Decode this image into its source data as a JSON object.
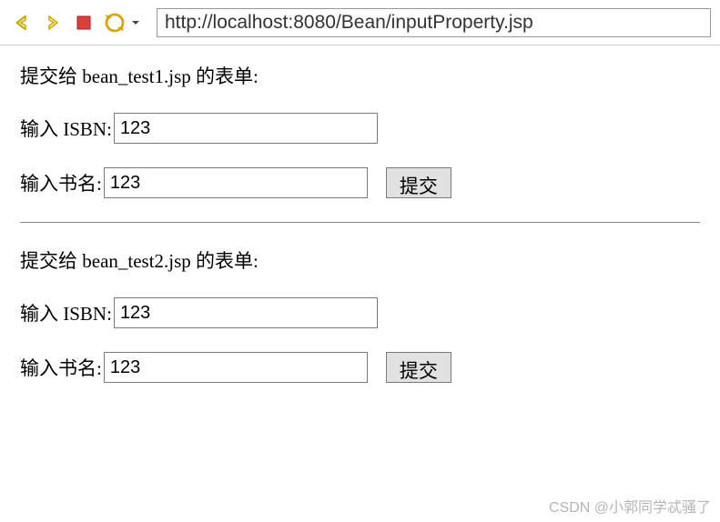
{
  "toolbar": {
    "url": "http://localhost:8080/Bean/inputProperty.jsp"
  },
  "form1": {
    "heading": "提交给 bean_test1.jsp 的表单:",
    "isbn_label": "输入 ISBN:",
    "isbn_value": "123",
    "name_label": "输入书名:",
    "name_value": "123",
    "submit_label": "提交"
  },
  "form2": {
    "heading": "提交给 bean_test2.jsp 的表单:",
    "isbn_label": "输入 ISBN:",
    "isbn_value": "123",
    "name_label": "输入书名:",
    "name_value": "123",
    "submit_label": "提交"
  },
  "watermark": "CSDN @小郭同学忒骚了"
}
